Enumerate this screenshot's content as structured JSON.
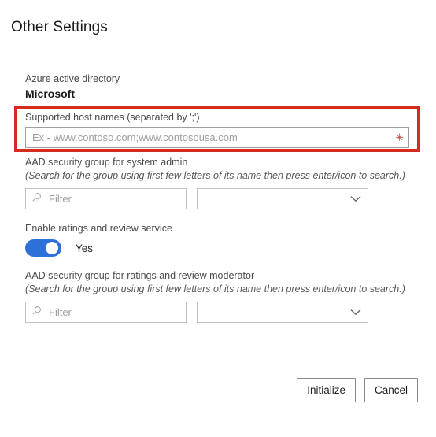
{
  "page": {
    "title": "Other Settings"
  },
  "directory": {
    "label": "Azure active directory",
    "value": "Microsoft"
  },
  "host_names": {
    "label": "Supported host names (separated by ';')",
    "placeholder": "Ex - www.contoso.com;www.contosousa.com",
    "value": "",
    "required_marker": "✳",
    "highlight_color": "#d62a1e"
  },
  "system_admin_group": {
    "label": "AAD security group for system admin",
    "hint": "(Search for the group using first few letters of its name then press enter/icon to search.)",
    "filter_placeholder": "Filter",
    "filter_value": "",
    "dropdown_value": ""
  },
  "ratings_service": {
    "label": "Enable ratings and review service",
    "toggle_state_label": "Yes",
    "toggle_on": true,
    "toggle_color": "#2f6fd9"
  },
  "moderator_group": {
    "label": "AAD security group for ratings and review moderator",
    "hint": "(Search for the group using first few letters of its name then press enter/icon to search.)",
    "filter_placeholder": "Filter",
    "filter_value": "",
    "dropdown_value": ""
  },
  "footer": {
    "initialize_label": "Initialize",
    "cancel_label": "Cancel"
  }
}
